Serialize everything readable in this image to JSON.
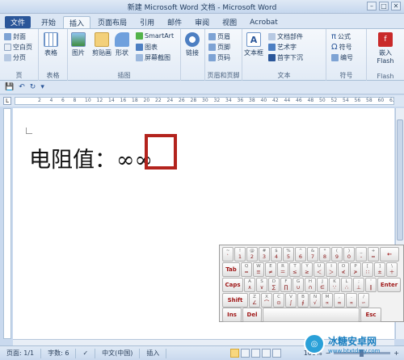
{
  "window": {
    "title": "新建 Microsoft Word 文档 - Microsoft Word"
  },
  "tabs": [
    "文件",
    "开始",
    "插入",
    "页面布局",
    "引用",
    "邮件",
    "审阅",
    "视图",
    "Acrobat"
  ],
  "ribbon": {
    "pages_group": {
      "label": "页",
      "items": [
        "封面",
        "空白页",
        "分页"
      ]
    },
    "table_group": {
      "label": "表格",
      "button": "表格"
    },
    "illustrations_group": {
      "label": "插图",
      "buttons": [
        "图片",
        "剪贴画",
        "形状"
      ],
      "small": [
        "SmartArt",
        "图表",
        "屏幕截图"
      ]
    },
    "links_group": {
      "button": "链接"
    },
    "header_group": {
      "label": "页眉和页脚",
      "items": [
        "页眉",
        "页脚",
        "页码"
      ]
    },
    "text_group": {
      "label": "文本",
      "button": "文本框",
      "small": [
        "文档部件",
        "艺术字",
        "首字下沉"
      ]
    },
    "symbols_group": {
      "label": "符号",
      "items": [
        "公式",
        "符号",
        "编号"
      ]
    },
    "flash_group": {
      "label": "Flash",
      "button": "嵌入 Flash"
    }
  },
  "ruler": {
    "numbers": [
      "2",
      "4",
      "6",
      "8",
      "10",
      "12",
      "14",
      "16",
      "18",
      "20",
      "22",
      "24",
      "26",
      "28",
      "30",
      "32",
      "34",
      "36",
      "38",
      "40",
      "42",
      "44",
      "46",
      "48",
      "50",
      "52",
      "54",
      "56",
      "58",
      "60",
      "62"
    ]
  },
  "document": {
    "text": "电阻值：∞∞"
  },
  "statusbar": {
    "page": "页面: 1/1",
    "words": "字数: 6",
    "language": "中文(中国)",
    "mode": "插入",
    "zoom": "100%"
  },
  "keyboard": {
    "row1": [
      [
        "`",
        "~"
      ],
      [
        "1",
        "!"
      ],
      [
        "2",
        "@"
      ],
      [
        "3",
        "#"
      ],
      [
        "4",
        "$"
      ],
      [
        "5",
        "%"
      ],
      [
        "6",
        "^"
      ],
      [
        "7",
        "&"
      ],
      [
        "8",
        "*"
      ],
      [
        "9",
        "("
      ],
      [
        "0",
        ")"
      ],
      [
        "-",
        "_"
      ],
      [
        "=",
        "+"
      ]
    ],
    "row1_end": "←",
    "tab": "Tab",
    "row2": [
      [
        "Q",
        "≈"
      ],
      [
        "W",
        "≡"
      ],
      [
        "E",
        "≠"
      ],
      [
        "R",
        "＝"
      ],
      [
        "T",
        "≤"
      ],
      [
        "Y",
        "≥"
      ],
      [
        "U",
        "＜"
      ],
      [
        "I",
        "＞"
      ],
      [
        "O",
        "≮"
      ],
      [
        "P",
        "≯"
      ],
      [
        "[",
        "∷"
      ],
      [
        "]",
        "±"
      ],
      [
        "\\",
        "＋"
      ]
    ],
    "caps": "Caps",
    "row3": [
      [
        "A",
        "∧"
      ],
      [
        "S",
        "∨"
      ],
      [
        "D",
        "∑"
      ],
      [
        "F",
        "∏"
      ],
      [
        "G",
        "∪"
      ],
      [
        "H",
        "∩"
      ],
      [
        "J",
        "∈"
      ],
      [
        "K",
        "∵"
      ],
      [
        "L",
        "∴"
      ],
      [
        ";",
        "⊥"
      ],
      [
        "'",
        "∥"
      ]
    ],
    "enter": "Enter",
    "shift": "Shift",
    "row4": [
      [
        "Z",
        "∠"
      ],
      [
        "X",
        "⌒"
      ],
      [
        "C",
        "⊙"
      ],
      [
        "V",
        "∫"
      ],
      [
        "B",
        "∮"
      ],
      [
        "N",
        "√"
      ],
      [
        "M",
        "∝"
      ],
      [
        ",",
        "∞"
      ],
      [
        ".",
        "∝"
      ],
      [
        "/",
        "∽"
      ]
    ],
    "ins": "Ins",
    "del": "Del",
    "esc": "Esc"
  },
  "watermark": {
    "name": "冰糖安卓网",
    "url": "www.btxtdmy.com"
  }
}
